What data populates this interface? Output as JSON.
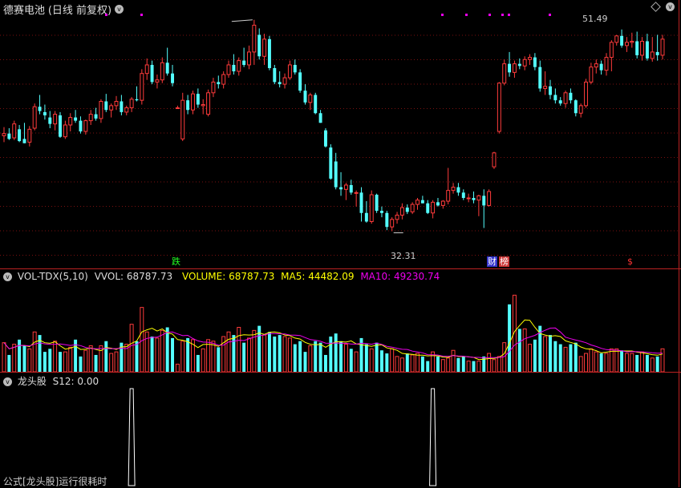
{
  "title": {
    "stock_name": "德赛电池",
    "period": "(日线 前复权)",
    "collapse_glyph": "v",
    "settings_glyph": "v"
  },
  "price_panel": {
    "high_label": "51.49",
    "low_label": "32.31",
    "event_tags": [
      {
        "text": "跌",
        "color": "#2f2"
      },
      {
        "text": "财",
        "color": "#fff",
        "bg": "#33c"
      },
      {
        "text": "榜",
        "color": "#fff",
        "bg": "#c33"
      },
      {
        "text": "$",
        "color": "#f33"
      }
    ]
  },
  "volume_panel": {
    "indicator": "VOL-TDX(5,10)",
    "vvol_label": "VVOL: 68787.73",
    "volume_label": "VOLUME: 68787.73",
    "ma5_label": "MA5: 44482.09",
    "ma10_label": "MA10: 49230.74",
    "colors": {
      "vvol": "#ddd",
      "volume": "#ff0",
      "ma5": "#ff0",
      "ma10": "#e0e"
    }
  },
  "indicator_panel": {
    "name": "龙头股",
    "value_label": "S12: 0.00"
  },
  "status_bar": {
    "message": "公式[龙头股]运行很耗时"
  },
  "colors": {
    "up": "#ff3b3b",
    "down": "#54ffff",
    "border": "#b22222"
  },
  "chart_data": {
    "type": "candlestick",
    "price_range": [
      30.5,
      53.5
    ],
    "candles": [
      {
        "o": 41.6,
        "h": 42.4,
        "l": 41.0,
        "c": 41.8,
        "up": true
      },
      {
        "o": 41.8,
        "h": 42.3,
        "l": 41.2,
        "c": 41.3,
        "up": false
      },
      {
        "o": 41.4,
        "h": 43.0,
        "l": 41.2,
        "c": 42.7,
        "up": true
      },
      {
        "o": 42.2,
        "h": 42.6,
        "l": 41.0,
        "c": 41.1,
        "up": false
      },
      {
        "o": 41.3,
        "h": 42.8,
        "l": 40.9,
        "c": 40.9,
        "up": false
      },
      {
        "o": 41.0,
        "h": 42.5,
        "l": 40.6,
        "c": 42.2,
        "up": true
      },
      {
        "o": 42.3,
        "h": 44.6,
        "l": 42.1,
        "c": 44.3,
        "up": true
      },
      {
        "o": 44.3,
        "h": 45.4,
        "l": 43.6,
        "c": 43.9,
        "up": false
      },
      {
        "o": 43.8,
        "h": 44.5,
        "l": 43.1,
        "c": 43.5,
        "up": false
      },
      {
        "o": 43.3,
        "h": 43.9,
        "l": 42.3,
        "c": 42.7,
        "up": false
      },
      {
        "o": 42.7,
        "h": 43.9,
        "l": 42.1,
        "c": 43.6,
        "up": true
      },
      {
        "o": 43.5,
        "h": 43.8,
        "l": 41.4,
        "c": 41.5,
        "up": false
      },
      {
        "o": 41.5,
        "h": 43.0,
        "l": 41.3,
        "c": 42.6,
        "up": true
      },
      {
        "o": 42.6,
        "h": 43.7,
        "l": 42.0,
        "c": 43.3,
        "up": true
      },
      {
        "o": 43.3,
        "h": 44.0,
        "l": 42.8,
        "c": 43.0,
        "up": false
      },
      {
        "o": 43.0,
        "h": 43.4,
        "l": 41.8,
        "c": 42.0,
        "up": false
      },
      {
        "o": 42.0,
        "h": 43.1,
        "l": 41.7,
        "c": 43.0,
        "up": true
      },
      {
        "o": 43.0,
        "h": 44.0,
        "l": 42.6,
        "c": 43.6,
        "up": true
      },
      {
        "o": 43.6,
        "h": 44.2,
        "l": 43.0,
        "c": 43.2,
        "up": false
      },
      {
        "o": 43.2,
        "h": 45.0,
        "l": 42.8,
        "c": 44.8,
        "up": true
      },
      {
        "o": 44.8,
        "h": 45.5,
        "l": 43.8,
        "c": 44.0,
        "up": false
      },
      {
        "o": 44.0,
        "h": 44.6,
        "l": 43.3,
        "c": 44.4,
        "up": true
      },
      {
        "o": 44.4,
        "h": 45.3,
        "l": 44.0,
        "c": 44.8,
        "up": true
      },
      {
        "o": 44.8,
        "h": 45.4,
        "l": 43.5,
        "c": 43.8,
        "up": false
      },
      {
        "o": 43.8,
        "h": 44.4,
        "l": 43.5,
        "c": 44.2,
        "up": true
      },
      {
        "o": 44.2,
        "h": 45.2,
        "l": 43.8,
        "c": 45.0,
        "up": true
      },
      {
        "o": 45.0,
        "h": 46.2,
        "l": 44.8,
        "c": 44.9,
        "up": false
      },
      {
        "o": 44.9,
        "h": 47.8,
        "l": 44.5,
        "c": 47.4,
        "up": true
      },
      {
        "o": 47.4,
        "h": 48.8,
        "l": 46.8,
        "c": 48.2,
        "up": true
      },
      {
        "o": 48.2,
        "h": 48.6,
        "l": 46.4,
        "c": 46.6,
        "up": false
      },
      {
        "o": 46.6,
        "h": 47.3,
        "l": 46.0,
        "c": 46.8,
        "up": true
      },
      {
        "o": 46.8,
        "h": 48.9,
        "l": 46.5,
        "c": 48.4,
        "up": true
      },
      {
        "o": 48.4,
        "h": 49.8,
        "l": 47.2,
        "c": 47.4,
        "up": false
      },
      {
        "o": 47.4,
        "h": 48.2,
        "l": 46.2,
        "c": 46.5,
        "up": false
      },
      {
        "o": 44.2,
        "h": 44.4,
        "l": 44.2,
        "c": 44.2,
        "up": true
      },
      {
        "o": 41.3,
        "h": 45.6,
        "l": 41.1,
        "c": 44.9,
        "up": true
      },
      {
        "o": 44.9,
        "h": 45.4,
        "l": 43.6,
        "c": 44.0,
        "up": false
      },
      {
        "o": 44.0,
        "h": 45.8,
        "l": 43.6,
        "c": 45.5,
        "up": true
      },
      {
        "o": 45.5,
        "h": 46.0,
        "l": 44.2,
        "c": 44.5,
        "up": false
      },
      {
        "o": 44.5,
        "h": 45.0,
        "l": 43.6,
        "c": 44.4,
        "up": true
      },
      {
        "o": 43.6,
        "h": 45.9,
        "l": 43.4,
        "c": 45.6,
        "up": true
      },
      {
        "o": 45.6,
        "h": 47.0,
        "l": 45.2,
        "c": 46.6,
        "up": true
      },
      {
        "o": 46.6,
        "h": 47.2,
        "l": 46.0,
        "c": 46.4,
        "up": false
      },
      {
        "o": 46.4,
        "h": 47.6,
        "l": 46.0,
        "c": 47.3,
        "up": true
      },
      {
        "o": 47.3,
        "h": 48.6,
        "l": 47.0,
        "c": 48.2,
        "up": true
      },
      {
        "o": 48.2,
        "h": 49.2,
        "l": 47.3,
        "c": 47.6,
        "up": false
      },
      {
        "o": 47.6,
        "h": 48.9,
        "l": 47.2,
        "c": 48.6,
        "up": true
      },
      {
        "o": 48.6,
        "h": 49.8,
        "l": 48.0,
        "c": 48.2,
        "up": false
      },
      {
        "o": 48.2,
        "h": 50.0,
        "l": 47.8,
        "c": 49.4,
        "up": true
      },
      {
        "o": 49.4,
        "h": 52.4,
        "l": 48.2,
        "c": 51.9,
        "up": true
      },
      {
        "o": 51.0,
        "h": 51.6,
        "l": 48.7,
        "c": 49.0,
        "up": false
      },
      {
        "o": 49.0,
        "h": 51.1,
        "l": 48.2,
        "c": 50.6,
        "up": true
      },
      {
        "o": 50.6,
        "h": 50.9,
        "l": 47.7,
        "c": 47.9,
        "up": false
      },
      {
        "o": 47.9,
        "h": 48.2,
        "l": 46.4,
        "c": 46.6,
        "up": false
      },
      {
        "o": 46.6,
        "h": 47.6,
        "l": 46.1,
        "c": 46.4,
        "up": false
      },
      {
        "o": 46.4,
        "h": 47.4,
        "l": 46.0,
        "c": 47.0,
        "up": true
      },
      {
        "o": 47.0,
        "h": 48.6,
        "l": 46.8,
        "c": 48.2,
        "up": true
      },
      {
        "o": 48.2,
        "h": 48.7,
        "l": 47.3,
        "c": 47.5,
        "up": false
      },
      {
        "o": 47.5,
        "h": 47.8,
        "l": 45.6,
        "c": 45.8,
        "up": false
      },
      {
        "o": 45.8,
        "h": 46.4,
        "l": 44.5,
        "c": 44.7,
        "up": false
      },
      {
        "o": 44.7,
        "h": 45.6,
        "l": 44.0,
        "c": 45.4,
        "up": true
      },
      {
        "o": 45.4,
        "h": 45.6,
        "l": 43.6,
        "c": 43.7,
        "up": false
      },
      {
        "o": 43.7,
        "h": 44.0,
        "l": 42.8,
        "c": 42.8,
        "up": false
      },
      {
        "o": 42.1,
        "h": 42.3,
        "l": 40.5,
        "c": 40.6,
        "up": false
      },
      {
        "o": 40.5,
        "h": 40.8,
        "l": 37.5,
        "c": 37.6,
        "up": false
      },
      {
        "o": 39.2,
        "h": 40.0,
        "l": 36.6,
        "c": 36.8,
        "up": false
      },
      {
        "o": 36.8,
        "h": 38.2,
        "l": 36.0,
        "c": 36.6,
        "up": false
      },
      {
        "o": 36.6,
        "h": 37.2,
        "l": 35.6,
        "c": 37.0,
        "up": true
      },
      {
        "o": 37.0,
        "h": 37.5,
        "l": 36.1,
        "c": 36.3,
        "up": false
      },
      {
        "o": 36.3,
        "h": 36.5,
        "l": 35.0,
        "c": 36.3,
        "up": true
      },
      {
        "o": 36.3,
        "h": 36.8,
        "l": 33.6,
        "c": 34.4,
        "up": false
      },
      {
        "o": 34.4,
        "h": 35.5,
        "l": 33.5,
        "c": 33.6,
        "up": false
      },
      {
        "o": 33.6,
        "h": 36.5,
        "l": 33.4,
        "c": 36.1,
        "up": true
      },
      {
        "o": 36.1,
        "h": 36.2,
        "l": 34.4,
        "c": 34.6,
        "up": false
      },
      {
        "o": 34.6,
        "h": 35.0,
        "l": 34.0,
        "c": 34.4,
        "up": false
      },
      {
        "o": 34.4,
        "h": 34.6,
        "l": 32.8,
        "c": 33.1,
        "up": false
      },
      {
        "o": 33.1,
        "h": 34.0,
        "l": 32.7,
        "c": 33.8,
        "up": true
      },
      {
        "o": 33.8,
        "h": 34.5,
        "l": 33.4,
        "c": 34.2,
        "up": true
      },
      {
        "o": 34.2,
        "h": 35.3,
        "l": 33.8,
        "c": 34.9,
        "up": true
      },
      {
        "o": 34.9,
        "h": 35.2,
        "l": 34.3,
        "c": 34.5,
        "up": false
      },
      {
        "o": 34.5,
        "h": 35.4,
        "l": 34.3,
        "c": 35.2,
        "up": true
      },
      {
        "o": 35.2,
        "h": 35.8,
        "l": 34.7,
        "c": 35.6,
        "up": true
      },
      {
        "o": 35.6,
        "h": 36.0,
        "l": 35.3,
        "c": 35.3,
        "up": false
      },
      {
        "o": 35.3,
        "h": 35.6,
        "l": 34.3,
        "c": 34.4,
        "up": false
      },
      {
        "o": 34.4,
        "h": 35.6,
        "l": 33.9,
        "c": 35.4,
        "up": true
      },
      {
        "o": 35.4,
        "h": 35.8,
        "l": 35.0,
        "c": 35.1,
        "up": false
      },
      {
        "o": 35.1,
        "h": 35.6,
        "l": 34.8,
        "c": 35.5,
        "up": true
      },
      {
        "o": 35.5,
        "h": 38.6,
        "l": 35.2,
        "c": 36.5,
        "up": true
      },
      {
        "o": 36.5,
        "h": 37.2,
        "l": 36.2,
        "c": 36.8,
        "up": true
      },
      {
        "o": 36.8,
        "h": 37.2,
        "l": 36.0,
        "c": 36.3,
        "up": false
      },
      {
        "o": 36.3,
        "h": 36.6,
        "l": 35.6,
        "c": 35.8,
        "up": false
      },
      {
        "o": 35.8,
        "h": 36.2,
        "l": 35.4,
        "c": 35.8,
        "up": true
      },
      {
        "o": 35.8,
        "h": 36.4,
        "l": 35.3,
        "c": 35.6,
        "up": false
      },
      {
        "o": 35.6,
        "h": 36.1,
        "l": 34.1,
        "c": 36.0,
        "up": true
      },
      {
        "o": 36.0,
        "h": 36.6,
        "l": 33.0,
        "c": 35.1,
        "up": false
      },
      {
        "o": 35.1,
        "h": 36.6,
        "l": 35.0,
        "c": 36.4,
        "up": true
      },
      {
        "o": 38.7,
        "h": 40.1,
        "l": 38.5,
        "c": 40.0,
        "up": true
      },
      {
        "o": 42.0,
        "h": 46.6,
        "l": 41.8,
        "c": 46.5,
        "up": true
      },
      {
        "o": 46.5,
        "h": 48.7,
        "l": 46.3,
        "c": 48.3,
        "up": true
      },
      {
        "o": 48.3,
        "h": 49.4,
        "l": 47.1,
        "c": 47.5,
        "up": false
      },
      {
        "o": 47.5,
        "h": 48.6,
        "l": 47.0,
        "c": 48.3,
        "up": true
      },
      {
        "o": 48.3,
        "h": 48.8,
        "l": 47.8,
        "c": 48.1,
        "up": false
      },
      {
        "o": 48.1,
        "h": 49.0,
        "l": 47.7,
        "c": 48.7,
        "up": true
      },
      {
        "o": 48.7,
        "h": 49.2,
        "l": 48.2,
        "c": 48.9,
        "up": true
      },
      {
        "o": 48.9,
        "h": 49.3,
        "l": 47.7,
        "c": 48.0,
        "up": false
      },
      {
        "o": 48.0,
        "h": 48.6,
        "l": 45.7,
        "c": 46.0,
        "up": false
      },
      {
        "o": 46.0,
        "h": 47.6,
        "l": 45.4,
        "c": 46.2,
        "up": true
      },
      {
        "o": 46.2,
        "h": 46.8,
        "l": 45.0,
        "c": 45.4,
        "up": false
      },
      {
        "o": 45.4,
        "h": 46.0,
        "l": 44.6,
        "c": 44.9,
        "up": false
      },
      {
        "o": 44.9,
        "h": 45.2,
        "l": 44.4,
        "c": 44.6,
        "up": false
      },
      {
        "o": 44.6,
        "h": 45.8,
        "l": 44.2,
        "c": 45.6,
        "up": true
      },
      {
        "o": 45.6,
        "h": 46.0,
        "l": 44.6,
        "c": 44.9,
        "up": false
      },
      {
        "o": 44.9,
        "h": 45.0,
        "l": 43.4,
        "c": 43.7,
        "up": false
      },
      {
        "o": 43.7,
        "h": 44.6,
        "l": 43.3,
        "c": 44.4,
        "up": true
      },
      {
        "o": 44.4,
        "h": 46.9,
        "l": 44.2,
        "c": 46.6,
        "up": true
      },
      {
        "o": 46.6,
        "h": 48.4,
        "l": 46.4,
        "c": 48.0,
        "up": true
      },
      {
        "o": 48.0,
        "h": 48.7,
        "l": 47.4,
        "c": 48.3,
        "up": true
      },
      {
        "o": 48.3,
        "h": 48.6,
        "l": 47.3,
        "c": 47.7,
        "up": false
      },
      {
        "o": 47.7,
        "h": 49.3,
        "l": 47.2,
        "c": 48.9,
        "up": true
      },
      {
        "o": 48.9,
        "h": 50.5,
        "l": 47.6,
        "c": 50.3,
        "up": true
      },
      {
        "o": 50.3,
        "h": 51.0,
        "l": 50.0,
        "c": 50.9,
        "up": true
      },
      {
        "o": 50.9,
        "h": 51.5,
        "l": 49.8,
        "c": 50.0,
        "up": false
      },
      {
        "o": 50.0,
        "h": 50.8,
        "l": 49.4,
        "c": 50.3,
        "up": true
      },
      {
        "o": 50.3,
        "h": 51.2,
        "l": 49.8,
        "c": 50.4,
        "up": true
      },
      {
        "o": 50.4,
        "h": 51.3,
        "l": 48.8,
        "c": 49.1,
        "up": false
      },
      {
        "o": 49.1,
        "h": 50.8,
        "l": 48.6,
        "c": 50.4,
        "up": true
      },
      {
        "o": 50.4,
        "h": 51.1,
        "l": 48.6,
        "c": 48.8,
        "up": false
      },
      {
        "o": 48.8,
        "h": 50.8,
        "l": 48.5,
        "c": 49.4,
        "up": true
      },
      {
        "o": 49.4,
        "h": 51.0,
        "l": 48.6,
        "c": 49.1,
        "up": false
      },
      {
        "o": 49.1,
        "h": 51.0,
        "l": 48.7,
        "c": 50.6,
        "up": true
      }
    ],
    "volume_range": [
      0,
      115000
    ],
    "volumes": [
      38000,
      22000,
      36000,
      42000,
      34000,
      30000,
      52000,
      48000,
      26000,
      30000,
      40000,
      26000,
      26000,
      32000,
      42000,
      20000,
      28000,
      34000,
      22000,
      34000,
      40000,
      24000,
      26000,
      38000,
      36000,
      62000,
      40000,
      84000,
      52000,
      46000,
      44000,
      54000,
      58000,
      44000,
      10000,
      40000,
      44000,
      42000,
      22000,
      30000,
      42000,
      40000,
      32000,
      46000,
      52000,
      48000,
      58000,
      38000,
      44000,
      54000,
      60000,
      48000,
      52000,
      46000,
      48000,
      46000,
      44000,
      36000,
      40000,
      26000,
      34000,
      40000,
      38000,
      22000,
      46000,
      50000,
      40000,
      36000,
      30000,
      26000,
      44000,
      36000,
      30000,
      38000,
      28000,
      24000,
      30000,
      20000,
      18000,
      24000,
      22000,
      24000,
      20000,
      14000,
      26000,
      20000,
      16000,
      18000,
      28000,
      18000,
      20000,
      14000,
      14000,
      14000,
      20000,
      24000,
      16000,
      20000,
      38000,
      88000,
      100000,
      56000,
      56000,
      36000,
      42000,
      60000,
      46000,
      48000,
      40000,
      36000,
      32000,
      36000,
      38000,
      20000,
      24000,
      30000,
      26000,
      24000,
      24000,
      30000,
      30000,
      28000,
      24000,
      24000,
      22000,
      26000,
      22000,
      18000,
      20000,
      30000
    ],
    "indicator_pulses_index": [
      25,
      84
    ]
  }
}
